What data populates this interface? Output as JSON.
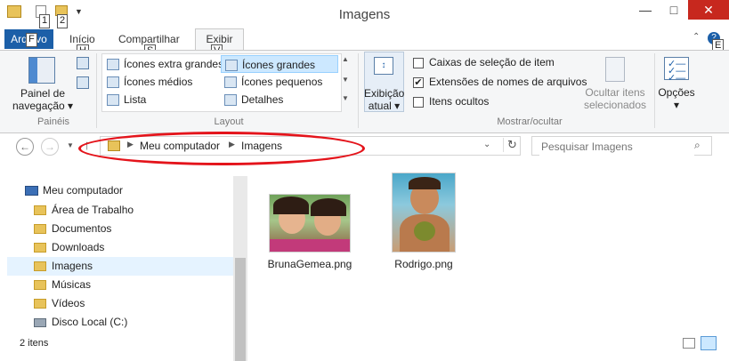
{
  "window": {
    "title": "Imagens",
    "minimize": "—",
    "maximize": "□",
    "close": "✕"
  },
  "qat": {
    "keytip1": "1",
    "keytip2": "2"
  },
  "tabs": {
    "file": "Arquivo",
    "file_keytip": "F",
    "home": "Início",
    "home_keytip": "H",
    "share": "Compartilhar",
    "share_keytip": "S",
    "view": "Exibir",
    "view_keytip": "V",
    "help_keytip": "E"
  },
  "ribbon": {
    "panes": {
      "nav_pane_line1": "Painel de",
      "nav_pane_line2": "navegação",
      "group": "Painéis"
    },
    "layout": {
      "group": "Layout",
      "items": [
        "Ícones extra grandes",
        "Ícones grandes",
        "Ícones médios",
        "Ícones pequenos",
        "Lista",
        "Detalhes"
      ],
      "selected": "Ícones grandes"
    },
    "current_view": {
      "line1": "Exibição",
      "line2": "atual"
    },
    "show_hide": {
      "group": "Mostrar/ocultar",
      "item_checkboxes": "Caixas de seleção de item",
      "item_checkboxes_checked": false,
      "extensions": "Extensões de nomes de arquivos",
      "extensions_checked": true,
      "hidden_items": "Itens ocultos",
      "hidden_items_checked": false,
      "hide_selected_line1": "Ocultar itens",
      "hide_selected_line2": "selecionados"
    },
    "options": "Opções"
  },
  "address": {
    "crumbs": [
      "Meu computador",
      "Imagens"
    ],
    "search_placeholder": "Pesquisar Imagens"
  },
  "nav_tree": {
    "root": "Meu computador",
    "items": [
      "Área de Trabalho",
      "Documentos",
      "Downloads",
      "Imagens",
      "Músicas",
      "Vídeos",
      "Disco Local (C:)"
    ],
    "selected": "Imagens"
  },
  "files": [
    {
      "name": "BrunaGemea.png"
    },
    {
      "name": "Rodrigo.png"
    }
  ],
  "status": {
    "count": "2 itens"
  },
  "colors": {
    "accent": "#1c5fa8",
    "close": "#c7281e",
    "annotation": "#e4141b",
    "selection": "#cce8ff"
  }
}
